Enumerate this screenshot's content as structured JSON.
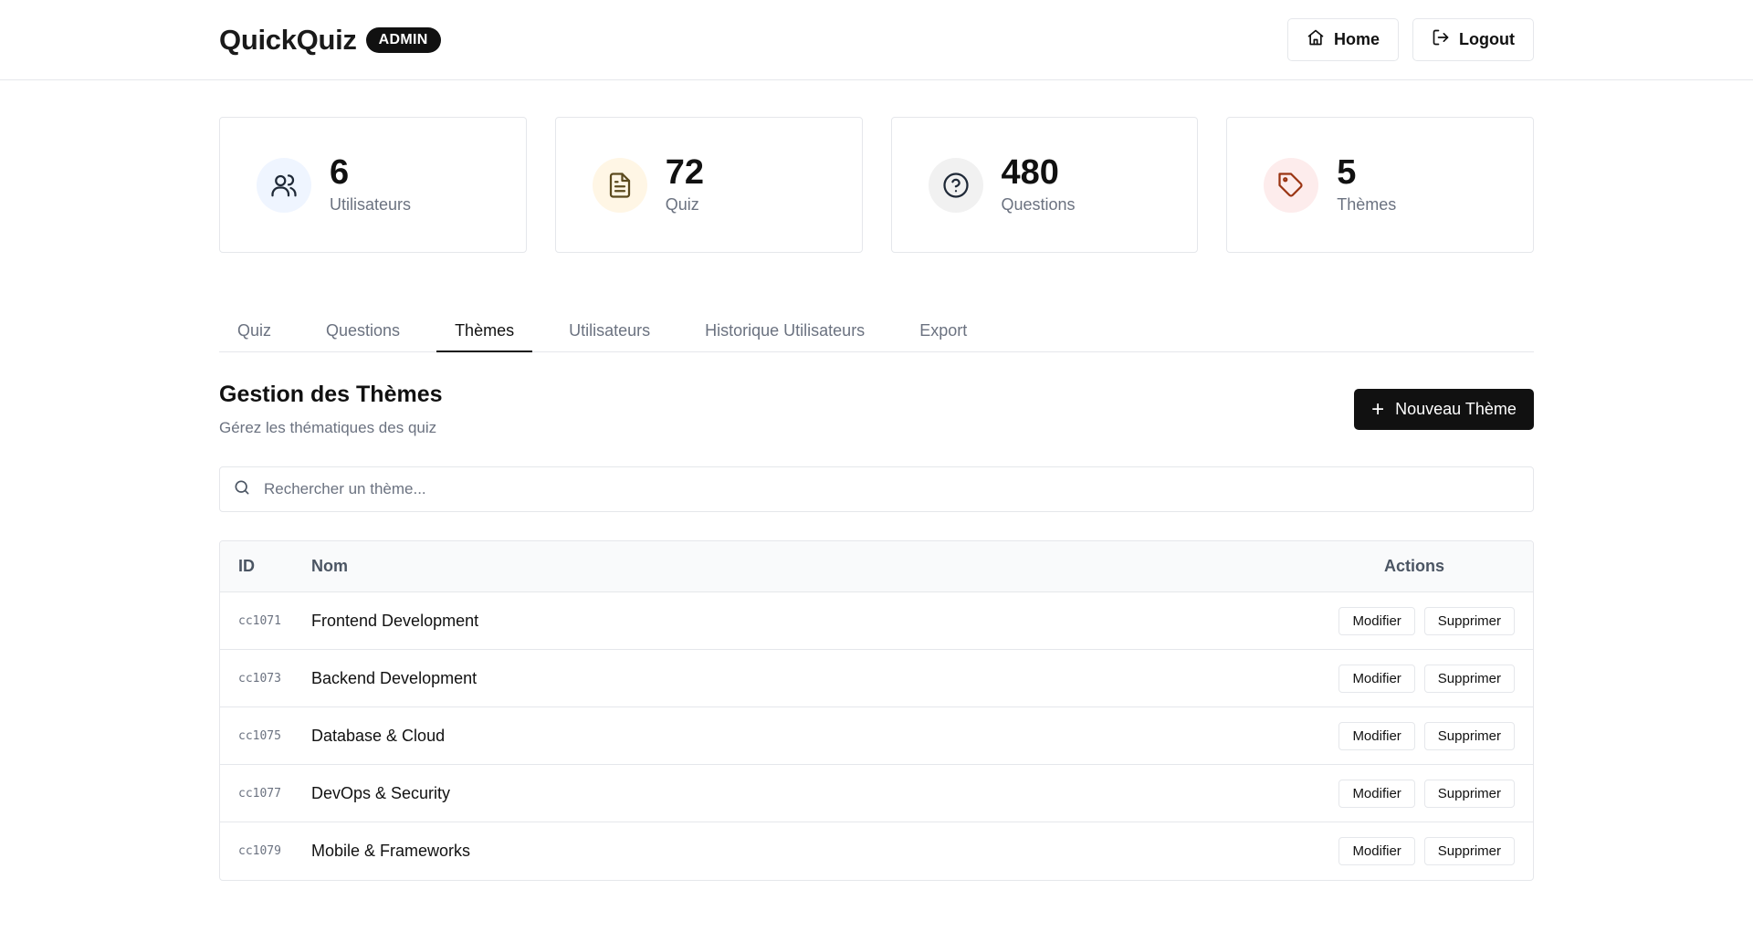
{
  "header": {
    "brand": "QuickQuiz",
    "badge": "ADMIN",
    "home_label": "Home",
    "logout_label": "Logout"
  },
  "stats": [
    {
      "value": "6",
      "label": "Utilisateurs",
      "icon": "users-icon",
      "bg": "#eff5ff"
    },
    {
      "value": "72",
      "label": "Quiz",
      "icon": "document-icon",
      "bg": "#fff6e5"
    },
    {
      "value": "480",
      "label": "Questions",
      "icon": "question-circle-icon",
      "bg": "#f1f1f1"
    },
    {
      "value": "5",
      "label": "Thèmes",
      "icon": "tag-icon",
      "bg": "#fdecec"
    }
  ],
  "tabs": [
    {
      "label": "Quiz"
    },
    {
      "label": "Questions"
    },
    {
      "label": "Thèmes",
      "active": true
    },
    {
      "label": "Utilisateurs"
    },
    {
      "label": "Historique Utilisateurs"
    },
    {
      "label": "Export"
    }
  ],
  "section": {
    "title": "Gestion des Thèmes",
    "subtitle": "Gérez les thématiques des quiz",
    "new_button": "Nouveau Thème"
  },
  "search": {
    "placeholder": "Rechercher un thème...",
    "value": ""
  },
  "table": {
    "headers": {
      "id": "ID",
      "name": "Nom",
      "actions": "Actions"
    },
    "rows": [
      {
        "id": "cc1071",
        "name": "Frontend Development",
        "edit": "Modifier",
        "delete": "Supprimer"
      },
      {
        "id": "cc1073",
        "name": "Backend Development",
        "edit": "Modifier",
        "delete": "Supprimer"
      },
      {
        "id": "cc1075",
        "name": "Database & Cloud",
        "edit": "Modifier",
        "delete": "Supprimer"
      },
      {
        "id": "cc1077",
        "name": "DevOps & Security",
        "edit": "Modifier",
        "delete": "Supprimer"
      },
      {
        "id": "cc1079",
        "name": "Mobile & Frameworks",
        "edit": "Modifier",
        "delete": "Supprimer"
      }
    ]
  },
  "colors": {
    "accent": "#111111",
    "muted": "#6b7280",
    "border": "#e5e7eb",
    "users_icon": "#1f2937",
    "quiz_icon": "#5b4a1e",
    "questions_icon": "#1f2937",
    "themes_icon": "#9a3412"
  }
}
